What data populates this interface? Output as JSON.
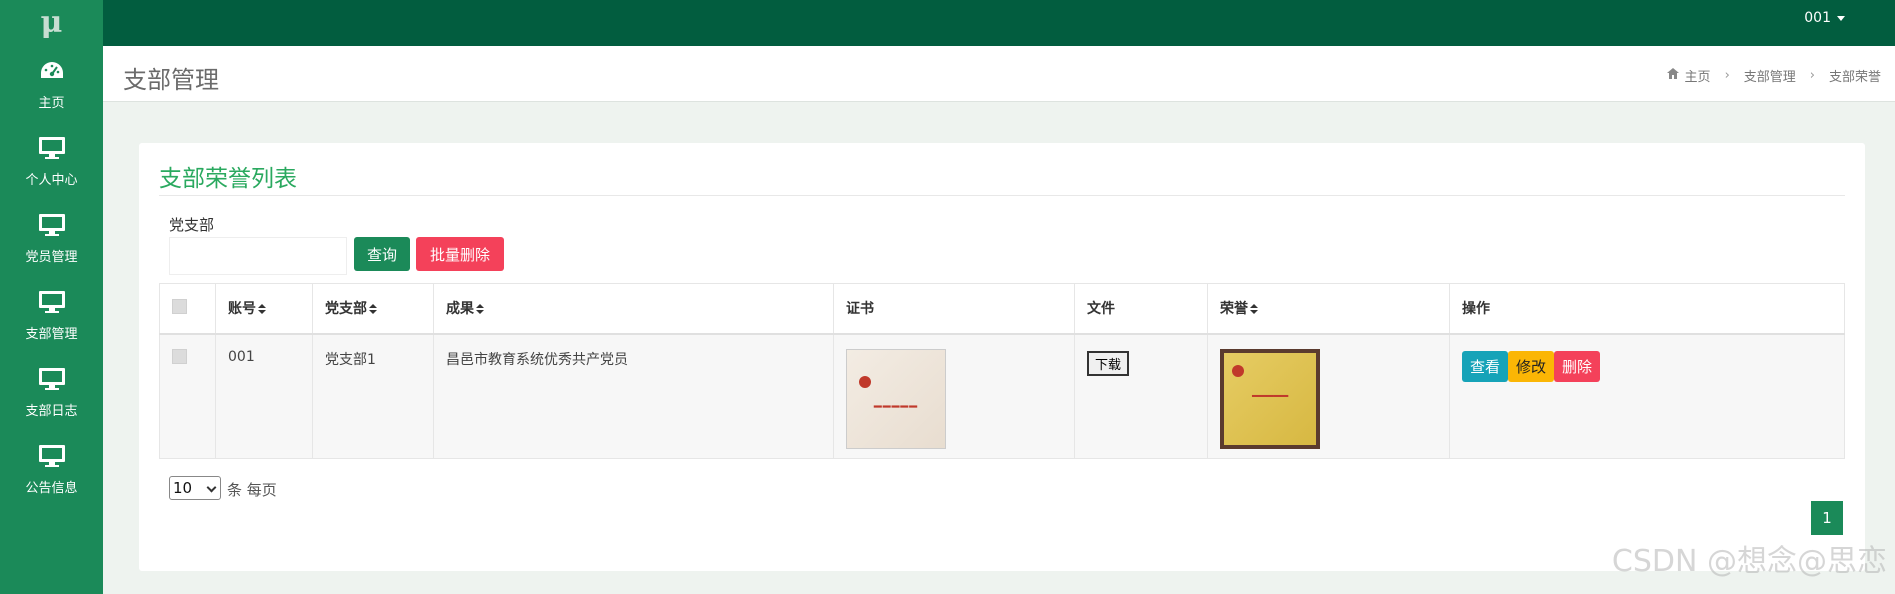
{
  "app": {
    "logo": "μ",
    "user": "001"
  },
  "sidebar": {
    "items": [
      {
        "label": "主页",
        "icon": "dashboard-icon"
      },
      {
        "label": "个人中心",
        "icon": "monitor-icon"
      },
      {
        "label": "党员管理",
        "icon": "monitor-icon"
      },
      {
        "label": "支部管理",
        "icon": "monitor-icon"
      },
      {
        "label": "支部日志",
        "icon": "monitor-icon"
      },
      {
        "label": "公告信息",
        "icon": "monitor-icon"
      }
    ]
  },
  "header": {
    "title": "支部管理",
    "breadcrumb": [
      "主页",
      "支部管理",
      "支部荣誉"
    ]
  },
  "card": {
    "title": "支部荣誉列表",
    "filter_label": "党支部",
    "filter_value": "",
    "query_label": "查询",
    "batch_delete_label": "批量删除"
  },
  "table": {
    "headers": [
      "账号",
      "党支部",
      "成果",
      "证书",
      "文件",
      "荣誉",
      "操作"
    ],
    "rows": [
      {
        "account": "001",
        "branch": "党支部1",
        "achievement": "昌邑市教育系统优秀共产党员",
        "download_label": "下载",
        "actions": [
          "查看",
          "修改",
          "删除"
        ]
      }
    ]
  },
  "pager": {
    "page_size": "10",
    "page_size_suffix": "条 每页",
    "current_page": "1"
  },
  "watermark": "CSDN @想念@思恋",
  "colors": {
    "topbar": "#025d3f",
    "sidebar": "#1b8a59",
    "accent": "#2aa95f",
    "danger": "#f4415a",
    "info": "#16a3b8",
    "warning": "#fbb605"
  }
}
